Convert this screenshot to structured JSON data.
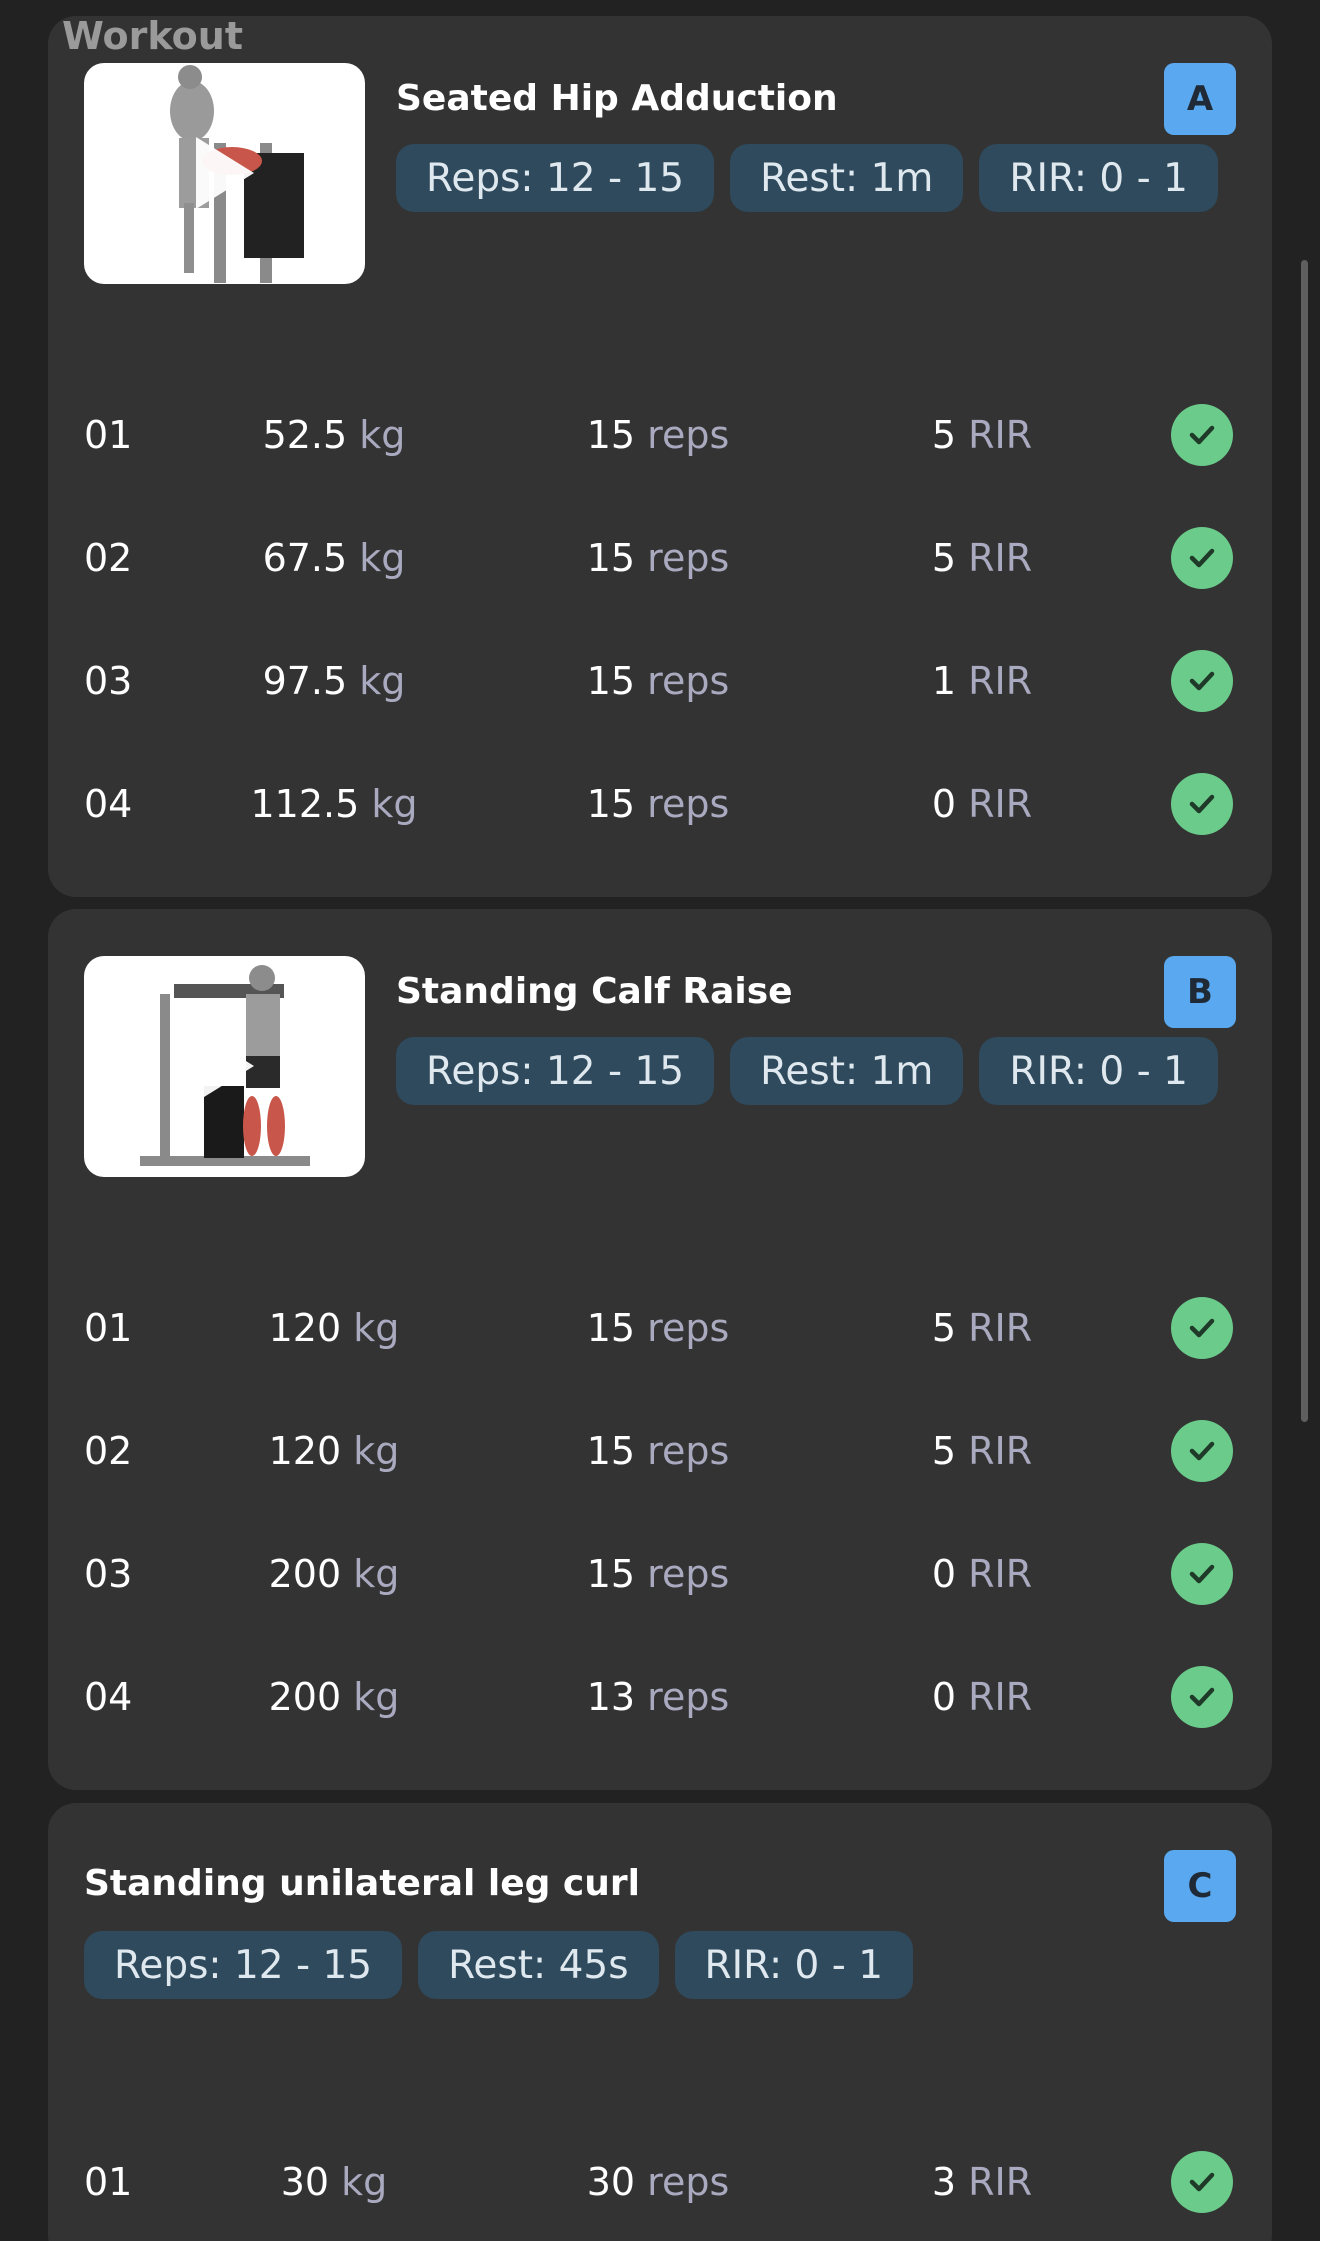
{
  "header": {
    "title": "Workout"
  },
  "exercises": [
    {
      "name": "Seated Hip Adduction",
      "badge": "A",
      "chips": {
        "reps": "Reps: 12 - 15",
        "rest": "Rest: 1m",
        "rir": "RIR: 0 - 1"
      },
      "sets": [
        {
          "num": "01",
          "weight": "52.5",
          "weight_unit": "kg",
          "reps": "15",
          "reps_unit": "reps",
          "rir": "5",
          "rir_unit": "RIR",
          "done": true
        },
        {
          "num": "02",
          "weight": "67.5",
          "weight_unit": "kg",
          "reps": "15",
          "reps_unit": "reps",
          "rir": "5",
          "rir_unit": "RIR",
          "done": true
        },
        {
          "num": "03",
          "weight": "97.5",
          "weight_unit": "kg",
          "reps": "15",
          "reps_unit": "reps",
          "rir": "1",
          "rir_unit": "RIR",
          "done": true
        },
        {
          "num": "04",
          "weight": "112.5",
          "weight_unit": "kg",
          "reps": "15",
          "reps_unit": "reps",
          "rir": "0",
          "rir_unit": "RIR",
          "done": true
        }
      ]
    },
    {
      "name": "Standing Calf Raise",
      "badge": "B",
      "chips": {
        "reps": "Reps: 12 - 15",
        "rest": "Rest: 1m",
        "rir": "RIR: 0 - 1"
      },
      "sets": [
        {
          "num": "01",
          "weight": "120",
          "weight_unit": "kg",
          "reps": "15",
          "reps_unit": "reps",
          "rir": "5",
          "rir_unit": "RIR",
          "done": true
        },
        {
          "num": "02",
          "weight": "120",
          "weight_unit": "kg",
          "reps": "15",
          "reps_unit": "reps",
          "rir": "5",
          "rir_unit": "RIR",
          "done": true
        },
        {
          "num": "03",
          "weight": "200",
          "weight_unit": "kg",
          "reps": "15",
          "reps_unit": "reps",
          "rir": "0",
          "rir_unit": "RIR",
          "done": true
        },
        {
          "num": "04",
          "weight": "200",
          "weight_unit": "kg",
          "reps": "13",
          "reps_unit": "reps",
          "rir": "0",
          "rir_unit": "RIR",
          "done": true
        }
      ]
    },
    {
      "name": "Standing unilateral leg curl",
      "badge": "C",
      "chips": {
        "reps": "Reps: 12 - 15",
        "rest": "Rest: 45s",
        "rir": "RIR: 0 - 1"
      },
      "sets": [
        {
          "num": "01",
          "weight": "30",
          "weight_unit": "kg",
          "reps": "30",
          "reps_unit": "reps",
          "rir": "3",
          "rir_unit": "RIR",
          "done": true
        }
      ]
    }
  ],
  "icons": {
    "check": "check-icon",
    "play": "play-icon"
  },
  "colors": {
    "card_bg": "#333333",
    "page_bg": "#222222",
    "chip_bg": "#2e4a5c",
    "badge_bg": "#5aa9f0",
    "check_bg": "#6acb8a"
  }
}
